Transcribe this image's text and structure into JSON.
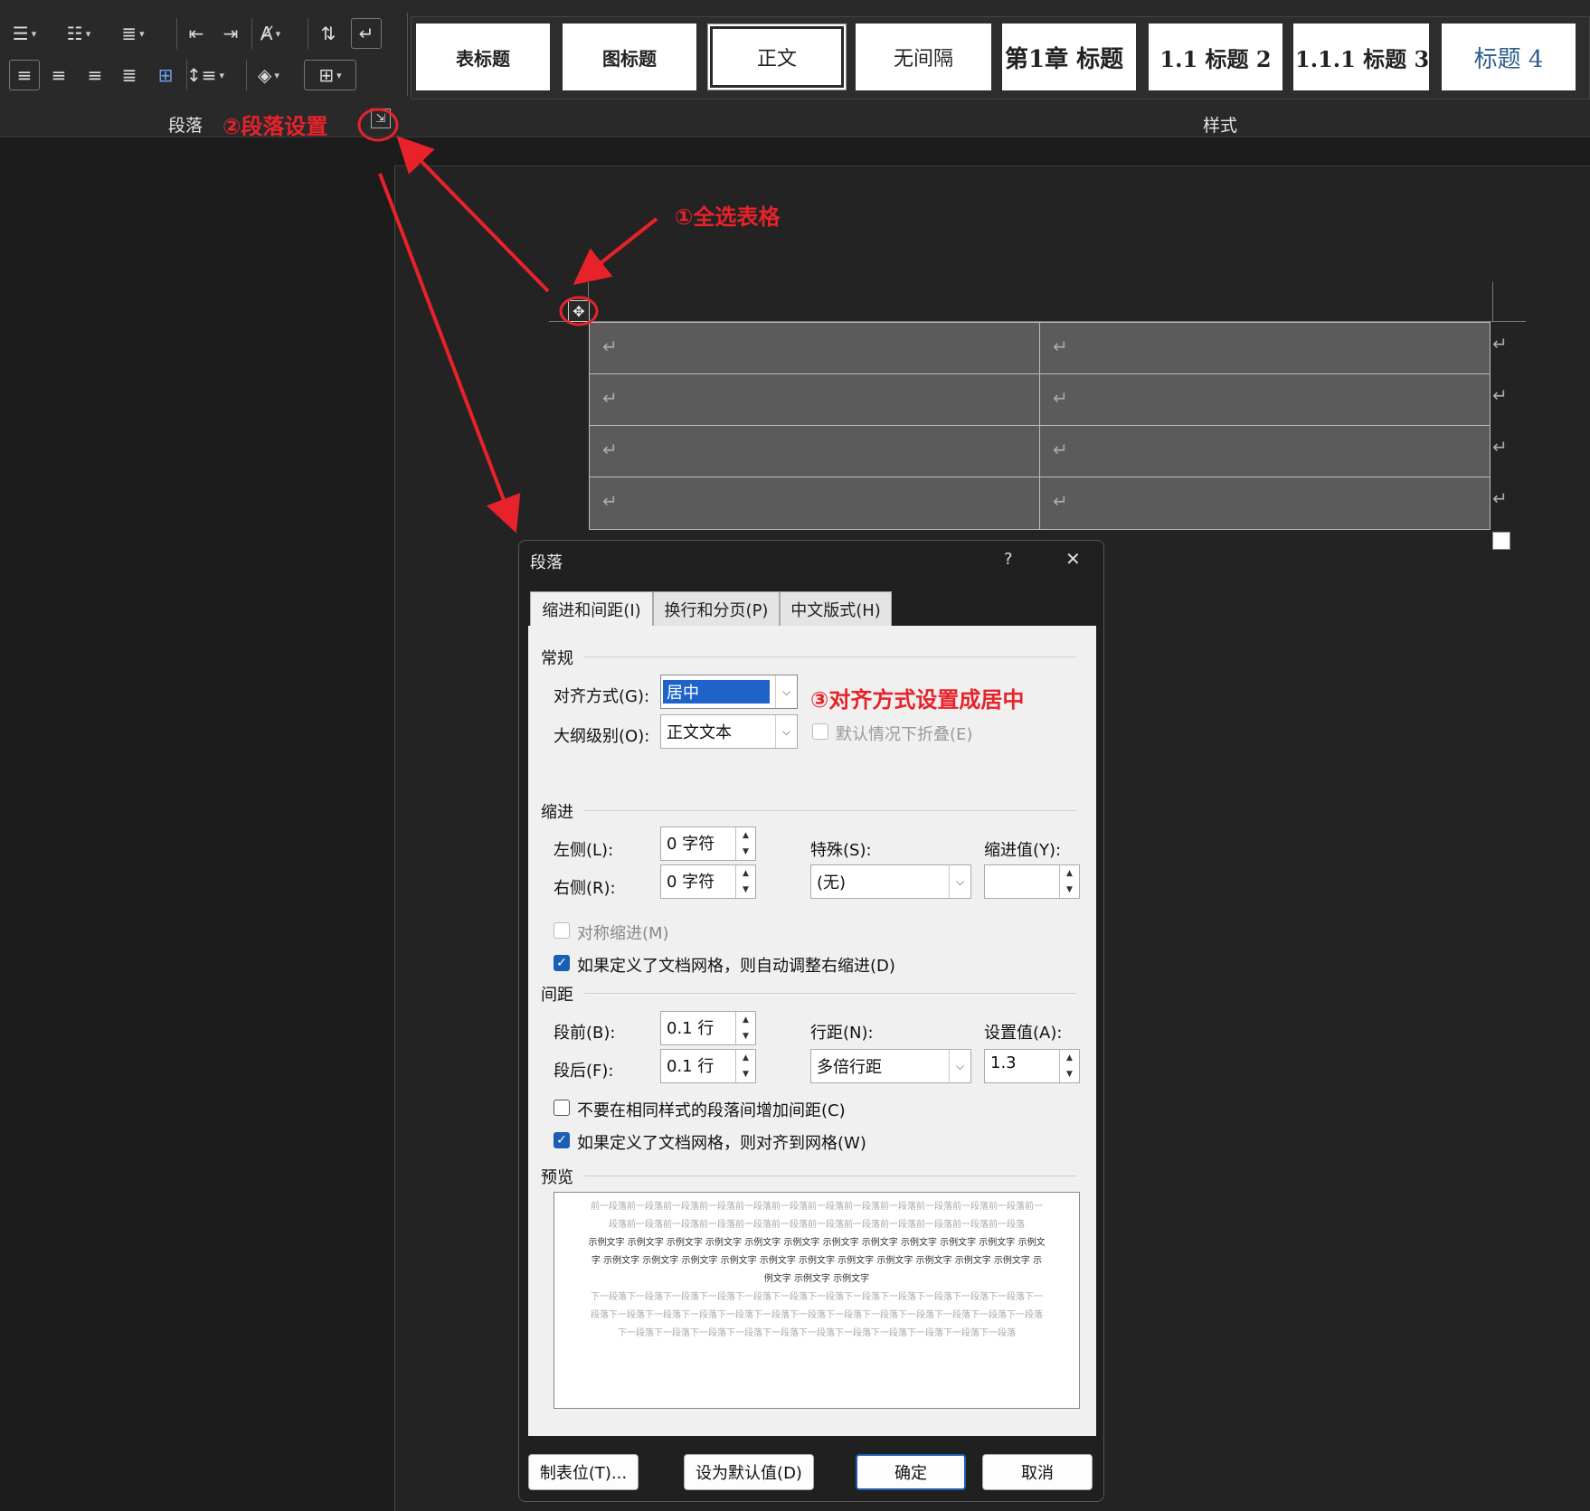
{
  "ribbon": {
    "paragraph_group_label": "段落",
    "styles_group_label": "样式",
    "styles": [
      "表标题",
      "图标题",
      "正文",
      "无间隔",
      "第1章  标题",
      "1.1  标题 2",
      "1.1.1  标题 3",
      "标题 4"
    ]
  },
  "annotations": {
    "step1": "①全选表格",
    "step2": "②段落设置",
    "step3": "③对齐方式设置成居中",
    "color": "#e8222a"
  },
  "table": {
    "rows": 4,
    "cols": 2,
    "para_mark": "↵"
  },
  "dialog": {
    "title": "段落",
    "help": "?",
    "close": "✕",
    "tabs": [
      "缩进和间距(I)",
      "换行和分页(P)",
      "中文版式(H)"
    ],
    "general": {
      "heading": "常规",
      "alignment_label": "对齐方式(G):",
      "alignment_value": "居中",
      "outline_label": "大纲级别(O):",
      "outline_value": "正文文本",
      "collapse_label": "默认情况下折叠(E)"
    },
    "indent": {
      "heading": "缩进",
      "left_label": "左侧(L):",
      "left_value": "0 字符",
      "right_label": "右侧(R):",
      "right_value": "0 字符",
      "special_label": "特殊(S):",
      "special_value": "(无)",
      "by_label": "缩进值(Y):",
      "by_value": "",
      "mirror_label": "对称缩进(M)",
      "auto_adjust_label": "如果定义了文档网格，则自动调整右缩进(D)"
    },
    "spacing": {
      "heading": "间距",
      "before_label": "段前(B):",
      "before_value": "0.1 行",
      "after_label": "段后(F):",
      "after_value": "0.1 行",
      "line_label": "行距(N):",
      "line_value": "多倍行距",
      "at_label": "设置值(A):",
      "at_value": "1.3",
      "no_space_label": "不要在相同样式的段落间增加间距(C)",
      "snap_grid_label": "如果定义了文档网格，则对齐到网格(W)"
    },
    "preview": {
      "heading": "预览",
      "prev_text": "前一段落前一段落前一段落前一段落前一段落前一段落前一段落前一段落前一段落前一段落前一段落前一段落前一段落前一段落前一段落前一段落前一段落前一段落前一段落前一段落前一段落前一段落前一段落前一段落",
      "sample_text": "示例文字 示例文字 示例文字 示例文字 示例文字 示例文字 示例文字 示例文字 示例文字 示例文字 示例文字 示例文字 示例文字 示例文字 示例文字 示例文字 示例文字 示例文字 示例文字 示例文字 示例文字 示例文字 示例文字 示例文字 示例文字 示例文字",
      "next_text": "下一段落下一段落下一段落下一段落下一段落下一段落下一段落下一段落下一段落下一段落下一段落下一段落下一段落下一段落下一段落下一段落下一段落下一段落下一段落下一段落下一段落下一段落下一段落下一段落下一段落下一段落下一段落下一段落下一段落下一段落下一段落下一段落下一段落下一段落下一段落下一段落"
    },
    "buttons": {
      "tabs": "制表位(T)...",
      "default": "设为默认值(D)",
      "ok": "确定",
      "cancel": "取消"
    }
  }
}
